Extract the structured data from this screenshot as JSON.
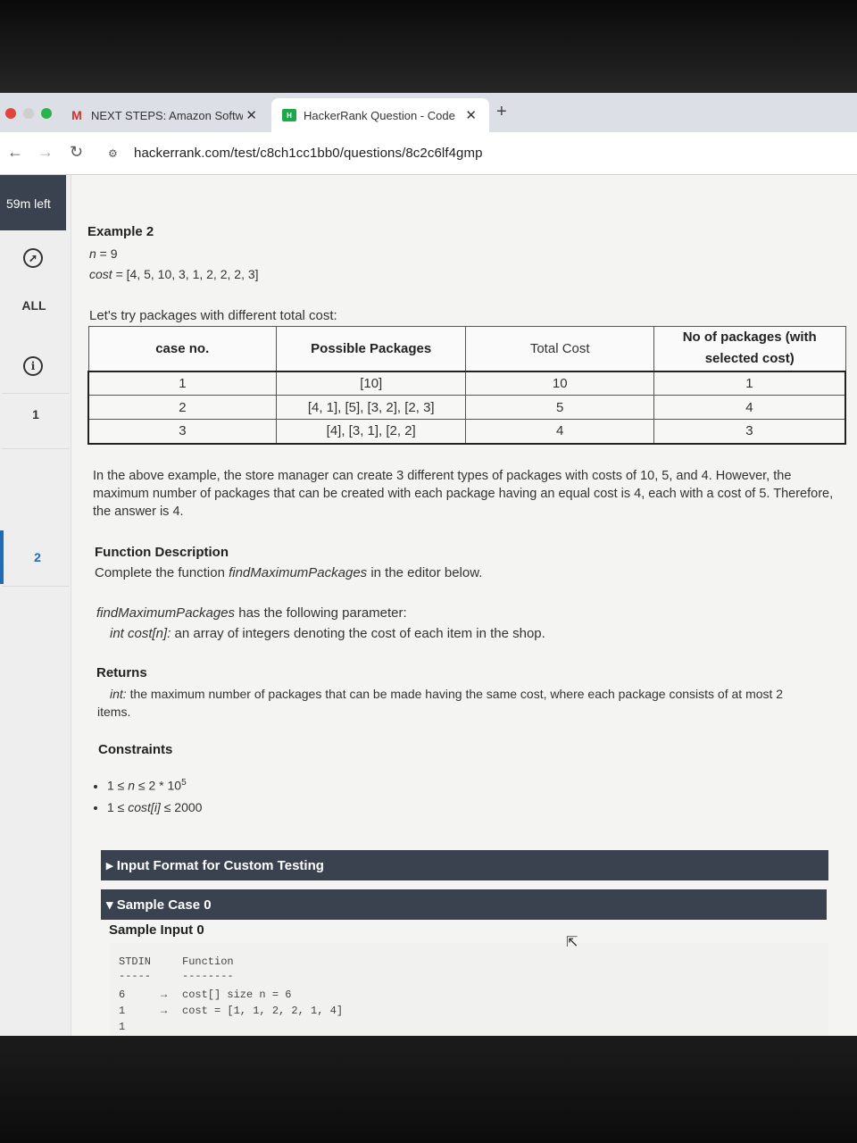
{
  "browser": {
    "tabs": [
      {
        "title": "NEXT STEPS: Amazon Softwa",
        "icon": "gmail-icon",
        "close": "✕"
      },
      {
        "title": "HackerRank Question - Code",
        "icon": "hackerrank-icon",
        "close": "✕"
      }
    ],
    "new_tab": "+",
    "url": "hackerrank.com/test/c8ch1cc1bb0/questions/8c2c6lf4gmp"
  },
  "rail": {
    "timer": "59m left",
    "all_label": "ALL",
    "question_numbers": [
      "1",
      "2"
    ]
  },
  "example": {
    "heading": "Example 2",
    "n_line": {
      "var": "n",
      "rest": " = 9"
    },
    "cost_line": {
      "var": "cost",
      "rest": " = [4, 5, 10, 3, 1, 2, 2, 2, 3]"
    },
    "intro": "Let's try packages with different total cost:"
  },
  "table": {
    "headers": [
      "case no.",
      "Possible Packages",
      "Total Cost",
      "No of packages (with selected cost)"
    ],
    "rows": [
      [
        "1",
        "[10]",
        "10",
        "1"
      ],
      [
        "2",
        "[4, 1], [5], [3, 2], [2, 3]",
        "5",
        "4"
      ],
      [
        "3",
        "[4], [3, 1], [2, 2]",
        "4",
        "3"
      ]
    ]
  },
  "explanation": "In the above example, the store manager can create 3 different types of packages with costs of 10, 5, and 4. However, the maximum number of packages that can be created with each package having an equal cost is 4, each with a cost of 5. Therefore, the answer is 4.",
  "function_description": {
    "heading": "Function Description",
    "line_prefix": "Complete the function ",
    "func_name": "findMaximumPackages",
    "line_suffix": " in the editor below.",
    "param_intro_suffix": " has the following parameter:",
    "param_type": "int cost[n]:",
    "param_desc": " an array of integers denoting the cost of each item in the shop."
  },
  "returns": {
    "heading": "Returns",
    "type": "int:",
    "desc": " the maximum number of packages that can be made having the same cost, where each package consists of at most 2 items."
  },
  "constraints": {
    "heading": "Constraints",
    "c1": {
      "a": "1 ≤ ",
      "var": "n",
      "b": " ≤ 2 * 10",
      "exp": "5"
    },
    "c2": {
      "a": "1 ≤ ",
      "var": "cost[i]",
      "b": " ≤ 2000"
    }
  },
  "sections": {
    "input_format": "▸ Input Format for Custom Testing",
    "sample_case": "▾ Sample Case 0",
    "sample_input": "Sample Input 0"
  },
  "sample": {
    "col1": "STDIN",
    "col2": "Function",
    "dash1": "-----",
    "dash2": "--------",
    "lines": [
      {
        "stdin": "6",
        "arrow": "→",
        "func": "cost[] size n = 6"
      },
      {
        "stdin": "1",
        "arrow": "→",
        "func": "cost = [1, 1, 2, 2, 1, 4]"
      },
      {
        "stdin": "1",
        "arrow": "",
        "func": ""
      }
    ]
  }
}
